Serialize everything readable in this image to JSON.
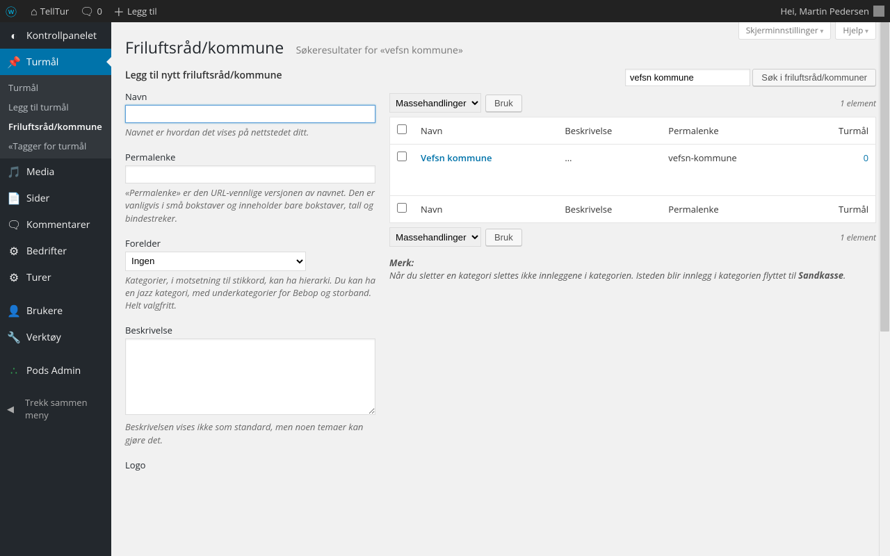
{
  "adminbar": {
    "site_name": "TellTur",
    "comments_count": "0",
    "add_new": "Legg til",
    "greeting": "Hei, Martin Pedersen"
  },
  "menu": {
    "dashboard": "Kontrollpanelet",
    "turmal": "Turmål",
    "sub_turmal": "Turmål",
    "sub_add": "Legg til turmål",
    "sub_friluft": "Friluftsråd/kommune",
    "sub_tags": "«Tagger for turmål",
    "media": "Media",
    "pages": "Sider",
    "comments": "Kommentarer",
    "bedrifter": "Bedrifter",
    "turer": "Turer",
    "users": "Brukere",
    "tools": "Verktøy",
    "pods": "Pods Admin",
    "collapse": "Trekk sammen meny"
  },
  "screen_meta": {
    "options": "Skjerminnstillinger",
    "help": "Hjelp"
  },
  "heading": {
    "title": "Friluftsråd/kommune",
    "subtitle": "Søkeresultater for «vefsn kommune»"
  },
  "form": {
    "title": "Legg til nytt friluftsråd/kommune",
    "name_label": "Navn",
    "name_desc": "Navnet er hvordan det vises på nettstedet ditt.",
    "slug_label": "Permalenke",
    "slug_desc": "«Permalenke» er den URL-vennlige versjonen av navnet. Den er vanligvis i små bokstaver og inneholder bare bokstaver, tall og bindestreker.",
    "parent_label": "Forelder",
    "parent_value": "Ingen",
    "parent_desc": "Kategorier, i motsetning til stikkord, kan ha hierarki. Du kan ha en jazz kategori, med underkategorier for Bebop og storband. Helt valgfritt.",
    "desc_label": "Beskrivelse",
    "desc_desc": "Beskrivelsen vises ikke som standard, men noen temaer kan gjøre det.",
    "logo_label": "Logo"
  },
  "search": {
    "value": "vefsn kommune",
    "button": "Søk i friluftsråd/kommuner"
  },
  "bulk": {
    "label": "Massehandlinger",
    "apply": "Bruk"
  },
  "pagination": "1 element",
  "table": {
    "col_name": "Navn",
    "col_desc": "Beskrivelse",
    "col_slug": "Permalenke",
    "col_count": "Turmål",
    "rows": [
      {
        "name": "Vefsn kommune",
        "desc": "…",
        "slug": "vefsn-kommune",
        "count": "0"
      }
    ]
  },
  "note": {
    "label": "Merk:",
    "text_a": "Når du sletter en kategori slettes ikke innleggene i kategorien. Isteden blir innlegg i kategorien flyttet til ",
    "text_b": "Sandkasse",
    "text_c": "."
  }
}
